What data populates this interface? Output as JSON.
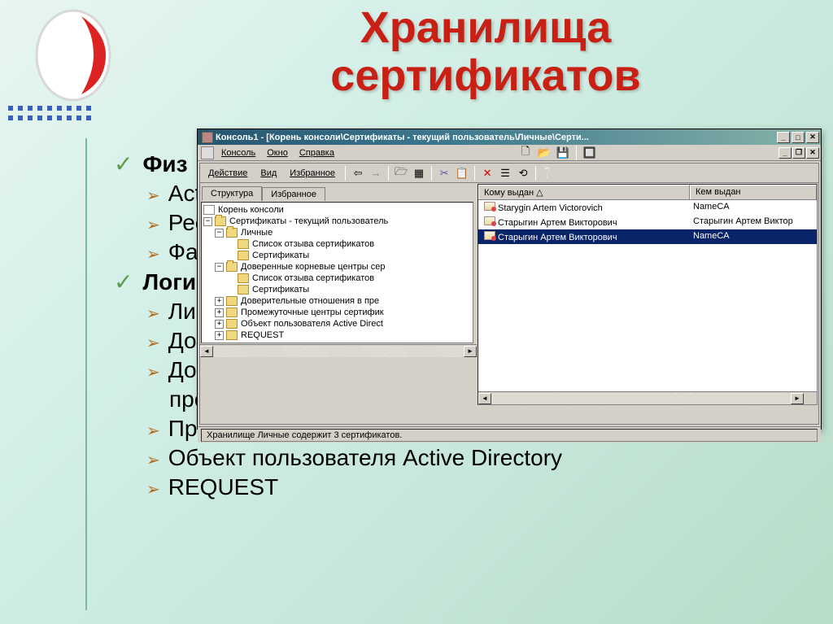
{
  "slide": {
    "title_l1": "Хранилища",
    "title_l2": "сертификатов",
    "bullets": {
      "phys": "Физ",
      "phys_items": [
        "Act",
        "Рее",
        "Фа"
      ],
      "logic": "Логи",
      "logic_items": [
        "Лич",
        "До",
        "До"
      ],
      "logic_pre": "пре",
      "visible": [
        "Промежуточные центры сертификации",
        "Объект пользователя Active Directory",
        "REQUEST"
      ]
    }
  },
  "mmc": {
    "title": "Консоль1 - [Корень консоли\\Сертификаты - текущий пользователь\\Личные\\Серти...",
    "menu1": [
      "Консоль",
      "Окно",
      "Справка"
    ],
    "menu2": [
      "Действие",
      "Вид",
      "Избранное"
    ],
    "tabs": [
      "Структура",
      "Избранное"
    ],
    "cols": [
      "Кому выдан   △",
      "Кем выдан"
    ],
    "rows": [
      {
        "who": "Starygin Artem Victorovich",
        "by": "NameCA",
        "sel": false
      },
      {
        "who": "Старыгин Артем Викторович",
        "by": "Старыгин Артем Виктор",
        "sel": false
      },
      {
        "who": "Старыгин Артем Викторович",
        "by": "NameCA",
        "sel": true
      }
    ],
    "tree": {
      "root": "Корень консоли",
      "cert_user": "Сертификаты - текущий пользователь",
      "personal": "Личные",
      "revlist": "Список отзыва сертификатов",
      "certs": "Сертификаты",
      "trusted_root": "Доверенные корневые центры сер",
      "revlist2": "Список отзыва сертификатов",
      "certs2": "Сертификаты",
      "trust_rel": "Доверительные отношения в пре",
      "intermediate": "Промежуточные центры сертифик",
      "ad_obj": "Объект пользователя Active Direct",
      "request": "REQUEST"
    },
    "status": "Хранилище Личные содержит 3 сертификатов."
  }
}
